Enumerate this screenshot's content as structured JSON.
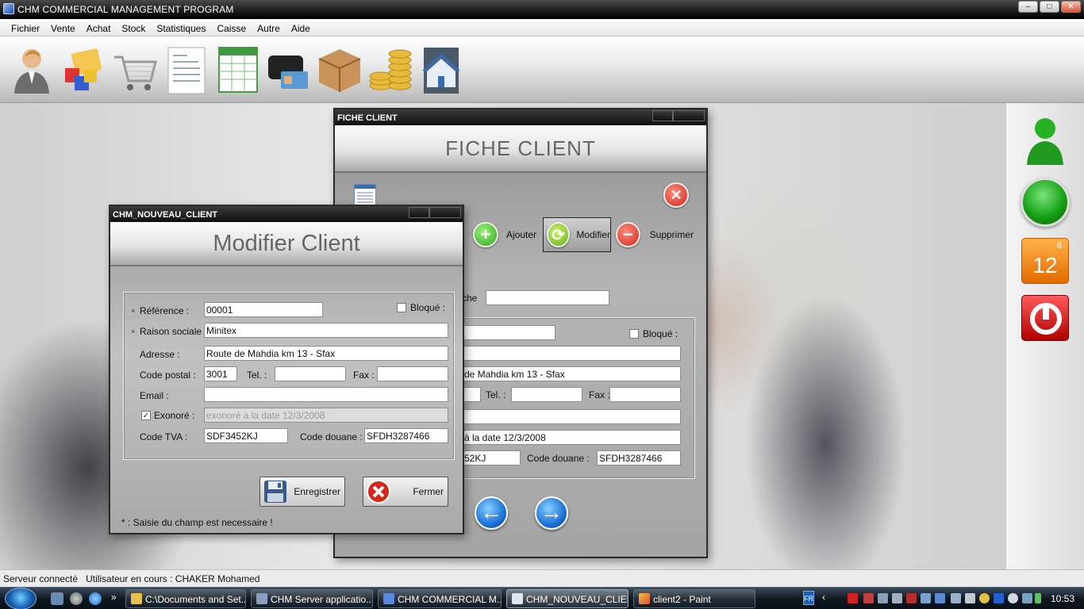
{
  "window": {
    "title": "CHM COMMERCIAL MANAGEMENT PROGRAM",
    "min": "–",
    "max": "□",
    "close": "✕"
  },
  "menu": [
    "Fichier",
    "Vente",
    "Achat",
    "Stock",
    "Statistiques",
    "Caisse",
    "Autre",
    "Aide"
  ],
  "toolbar": [
    "user-icon",
    "products-icon",
    "cart-icon",
    "invoice-icon",
    "spreadsheet-icon",
    "wallet-icon",
    "box-icon",
    "coins-icon",
    "home-icon"
  ],
  "side_panel": {
    "calendar_month": "6",
    "calendar_day": "12"
  },
  "fiche": {
    "title": "FICHE CLIENT",
    "header": "FICHE CLIENT",
    "ajouter": "Ajouter",
    "modifier": "Modifier",
    "supprimer": "Supprimer",
    "search_label": "che",
    "bloque": "Bloqué :",
    "adresse": "de Mahdia km 13 - Sfax",
    "tel": "Tel. :",
    "fax": "Fax :",
    "exonore": "à la date 12/3/2008",
    "code_tva": "52KJ",
    "code_douane_label": "Code douane :",
    "code_douane": "SFDH3287466"
  },
  "nouveau": {
    "title": "CHM_NOUVEAU_CLIENT",
    "header": "Modifier Client",
    "reference_label": "Référence :",
    "reference": "00001",
    "bloque": "Bloqué :",
    "raison_label": "Raison sociale :",
    "raison": "Minitex",
    "adresse_label": "Adresse :",
    "adresse": "Route de Mahdia km 13 - Sfax",
    "cp_label": "Code postal :",
    "cp": "3001",
    "tel_label": "Tel. :",
    "tel": "",
    "fax_label": "Fax :",
    "fax": "",
    "email_label": "Email :",
    "email": "",
    "exonore_label": "Exonoré :",
    "exonore": "exonoré à la date 12/3/2008",
    "tva_label": "Code TVA :",
    "tva": "SDF3452KJ",
    "douane_label": "Code douane :",
    "douane": "SFDH3287466",
    "save": "Enregistrer",
    "close": "Fermer",
    "note": "* : Saisie du champ est necessaire !"
  },
  "status": {
    "server": "Serveur connecté",
    "user": "Utilisateur en cours : CHAKER Mohamed"
  },
  "taskbar": {
    "tasks": [
      "C:\\Documents and Set...",
      "CHM Server applicatio...",
      "CHM COMMERCIAL M...",
      "CHM_NOUVEAU_CLIENT",
      "client2 - Paint"
    ],
    "lang": "FR",
    "clock": "10:53"
  }
}
